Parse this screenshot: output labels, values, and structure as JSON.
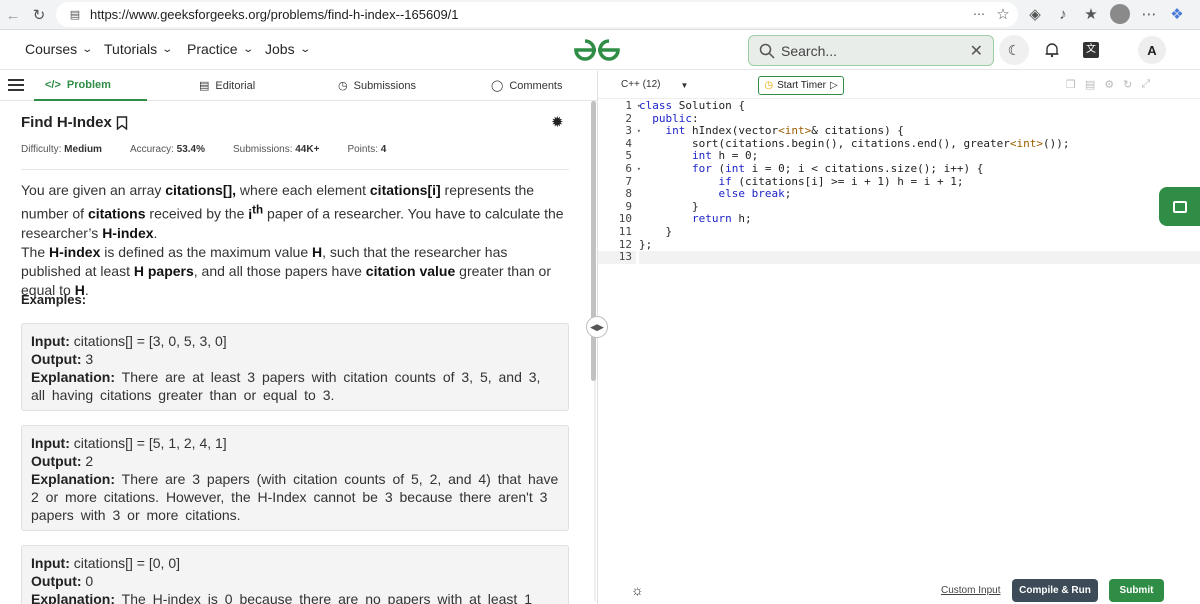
{
  "browser": {
    "url": "https://www.geeksforgeeks.org/problems/find-h-index--165609/1"
  },
  "navbar": {
    "items": [
      "Courses",
      "Tutorials",
      "Practice",
      "Jobs"
    ],
    "search_placeholder": "Search...",
    "avatar_letter": "A"
  },
  "tabs": {
    "problem": "Problem",
    "editorial": "Editorial",
    "submissions": "Submissions",
    "comments": "Comments"
  },
  "problem": {
    "title": "Find H-Index",
    "difficulty_label": "Difficulty:",
    "difficulty": "Medium",
    "accuracy_label": "Accuracy:",
    "accuracy": "53.4%",
    "submissions_label": "Submissions:",
    "submissions": "44K+",
    "points_label": "Points:",
    "points": "4",
    "examples_heading": "Examples:"
  },
  "examples": [
    {
      "input_label": "Input:",
      "input": "citations[] = [3, 0, 5, 3, 0]",
      "output_label": "Output:",
      "output": "3",
      "explanation_label": "Explanation:",
      "explanation": "There are at least 3 papers with citation counts of 3, 5, and 3, all having citations greater than or equal to 3."
    },
    {
      "input_label": "Input:",
      "input": "citations[] = [5, 1, 2, 4, 1]",
      "output_label": "Output:",
      "output": "2",
      "explanation_label": "Explanation:",
      "explanation": "There are 3 papers (with citation counts of 5, 2, and 4) that have 2 or more citations. However, the H-Index cannot be 3 because there aren't 3 papers with 3 or more citations."
    },
    {
      "input_label": "Input:",
      "input": "citations[] = [0, 0]",
      "output_label": "Output:",
      "output": "0",
      "explanation_label": "Explanation:",
      "explanation": "The H-index is 0 because there are no papers with at least 1"
    }
  ],
  "editor": {
    "language": "C++ (12)",
    "timer_label": "Start Timer",
    "custom_input": "Custom Input",
    "compile_label": "Compile & Run",
    "submit_label": "Submit"
  },
  "colors": {
    "brand": "#2f8d46",
    "compile_bg": "#3c4b57"
  }
}
